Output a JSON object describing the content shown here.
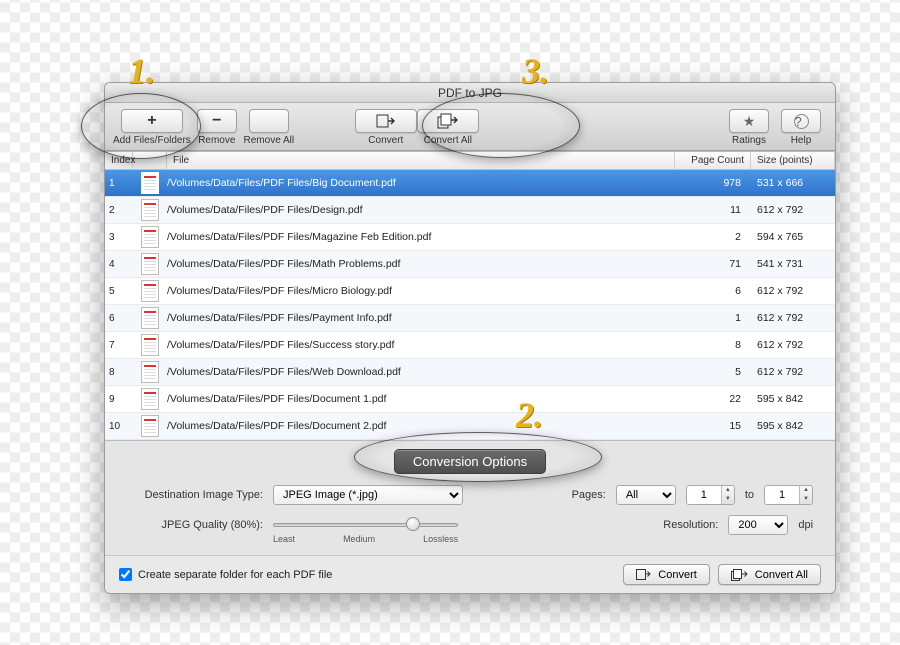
{
  "window_title": "PDF to JPG",
  "toolbar": {
    "add": "Add Files/Folders",
    "remove": "Remove",
    "remove_all": "Remove All",
    "convert": "Convert",
    "convert_all": "Convert All",
    "ratings": "Ratings",
    "help": "Help"
  },
  "columns": {
    "index": "Index",
    "file": "File",
    "page_count": "Page Count",
    "size": "Size (points)"
  },
  "rows": [
    {
      "idx": "1",
      "file": "/Volumes/Data/Files/PDF Files/Big Document.pdf",
      "pages": "978",
      "size": "531 x 666",
      "sel": true
    },
    {
      "idx": "2",
      "file": "/Volumes/Data/Files/PDF Files/Design.pdf",
      "pages": "11",
      "size": "612 x 792"
    },
    {
      "idx": "3",
      "file": "/Volumes/Data/Files/PDF Files/Magazine Feb Edition.pdf",
      "pages": "2",
      "size": "594 x 765"
    },
    {
      "idx": "4",
      "file": "/Volumes/Data/Files/PDF Files/Math Problems.pdf",
      "pages": "71",
      "size": "541 x 731"
    },
    {
      "idx": "5",
      "file": "/Volumes/Data/Files/PDF Files/Micro Biology.pdf",
      "pages": "6",
      "size": "612 x 792"
    },
    {
      "idx": "6",
      "file": "/Volumes/Data/Files/PDF Files/Payment Info.pdf",
      "pages": "1",
      "size": "612 x 792"
    },
    {
      "idx": "7",
      "file": "/Volumes/Data/Files/PDF Files/Success story.pdf",
      "pages": "8",
      "size": "612 x 792"
    },
    {
      "idx": "8",
      "file": "/Volumes/Data/Files/PDF Files/Web Download.pdf",
      "pages": "5",
      "size": "612 x 792"
    },
    {
      "idx": "9",
      "file": "/Volumes/Data/Files/PDF Files/Document 1.pdf",
      "pages": "22",
      "size": "595 x 842"
    },
    {
      "idx": "10",
      "file": "/Volumes/Data/Files/PDF Files/Document 2.pdf",
      "pages": "15",
      "size": "595 x 842"
    }
  ],
  "options": {
    "title": "Conversion Options",
    "dest_label": "Destination Image Type:",
    "dest_value": "JPEG Image (*.jpg)",
    "quality_label": "JPEG Quality (80%):",
    "quality_ticks": {
      "least": "Least",
      "medium": "Medium",
      "lossless": "Lossless"
    },
    "pages_label": "Pages:",
    "pages_mode": "All",
    "pages_from": "1",
    "pages_to_label": "to",
    "pages_to": "1",
    "res_label": "Resolution:",
    "res_value": "200",
    "res_unit": "dpi"
  },
  "footer": {
    "checkbox": "Create separate folder for each PDF file",
    "checked": true,
    "convert": "Convert",
    "convert_all": "Convert All"
  },
  "annotations": {
    "one": "1.",
    "two": "2.",
    "three": "3."
  }
}
